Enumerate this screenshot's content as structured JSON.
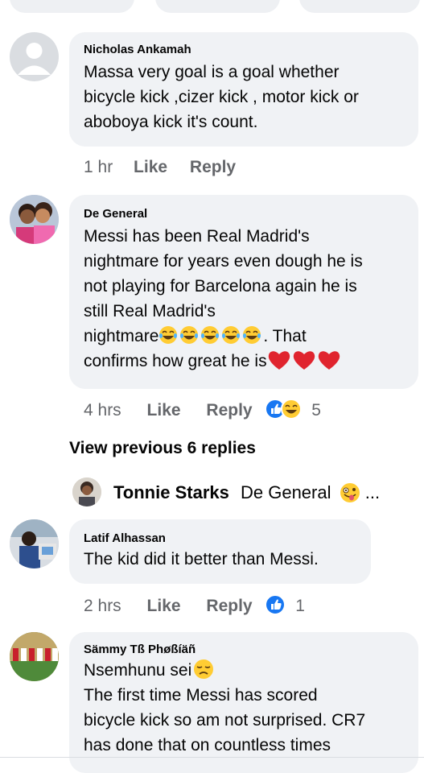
{
  "comments": [
    {
      "author": "Nicholas Ankamah",
      "lines": [
        "Massa very goal is a goal whether",
        "bicycle kick ,cizer kick , motor kick or",
        "aboboya kick it's count."
      ],
      "time": "1 hr",
      "like": "Like",
      "reply": "Reply"
    },
    {
      "author": "De General",
      "lines": [
        "Messi has been Real Madrid's",
        "nightmare for years even dough he is",
        "not playing for Barcelona again he is",
        "still Real Madrid's"
      ],
      "line5_text": "nightmare",
      "line5_suffix": ". That",
      "line6_text": "confirms how great he is",
      "time": "4 hrs",
      "like": "Like",
      "reply": "Reply",
      "reaction_count": "5"
    },
    {
      "author": "Latif Alhassan",
      "lines": [
        "The kid did it better than Messi."
      ],
      "time": "2 hrs",
      "like": "Like",
      "reply": "Reply",
      "reaction_count": "1"
    },
    {
      "author": "Sämmy Tß Phøßíäñ",
      "lines": [
        "Nsemhunu sei",
        "The first time Messi has scored",
        "bicycle kick so am not surprised. CR7",
        "has done that on countless times"
      ]
    }
  ],
  "view_previous": "View previous 6 replies",
  "reply_preview": {
    "author": "Tonnie Starks",
    "text": "De General",
    "ellipsis": "..."
  }
}
